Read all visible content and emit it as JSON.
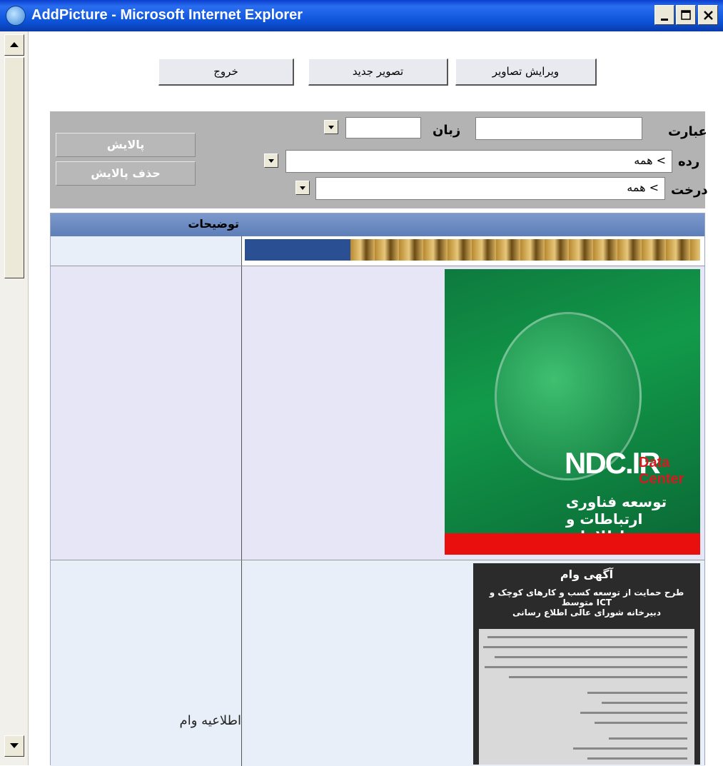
{
  "window": {
    "title": "AddPicture - Microsoft Internet Explorer"
  },
  "toolbar": {
    "exit_label": "خروج",
    "new_image_label": "تصویر جدید",
    "edit_images_label": "ویرایش تصاویر"
  },
  "filter": {
    "phrase_label": "عبارت",
    "phrase_value": "",
    "language_label": "زبان",
    "language_value": "",
    "category_label": "رده",
    "category_value": "همه <",
    "tree_label": "درخت",
    "tree_value": "همه <",
    "filter_button": "پالایش",
    "remove_filter_button": "حذف پالایش"
  },
  "table": {
    "description_header": "توضیحات",
    "rows": [
      {
        "description": ""
      },
      {
        "description": ""
      },
      {
        "description": "اطلاعیه وام"
      }
    ]
  },
  "images": {
    "ndc_main": "NDC.IR",
    "ndc_sub": "Data Center",
    "ndc_fa": "توسعه فناوری ارتباطات و اطلاعات",
    "loan_title": "آگهی وام",
    "loan_line1": "طرح حمایت از توسعه کسب و کارهای کوچک و متوسط ICT",
    "loan_line2": "دبیرخانه شورای عالی اطلاع رسانی"
  },
  "colors": {
    "titlebar": "#0b52d9",
    "table_header": "#6b8bc3",
    "row_bg": "#e6e6f7",
    "filter_bg": "#b3b3b3"
  }
}
